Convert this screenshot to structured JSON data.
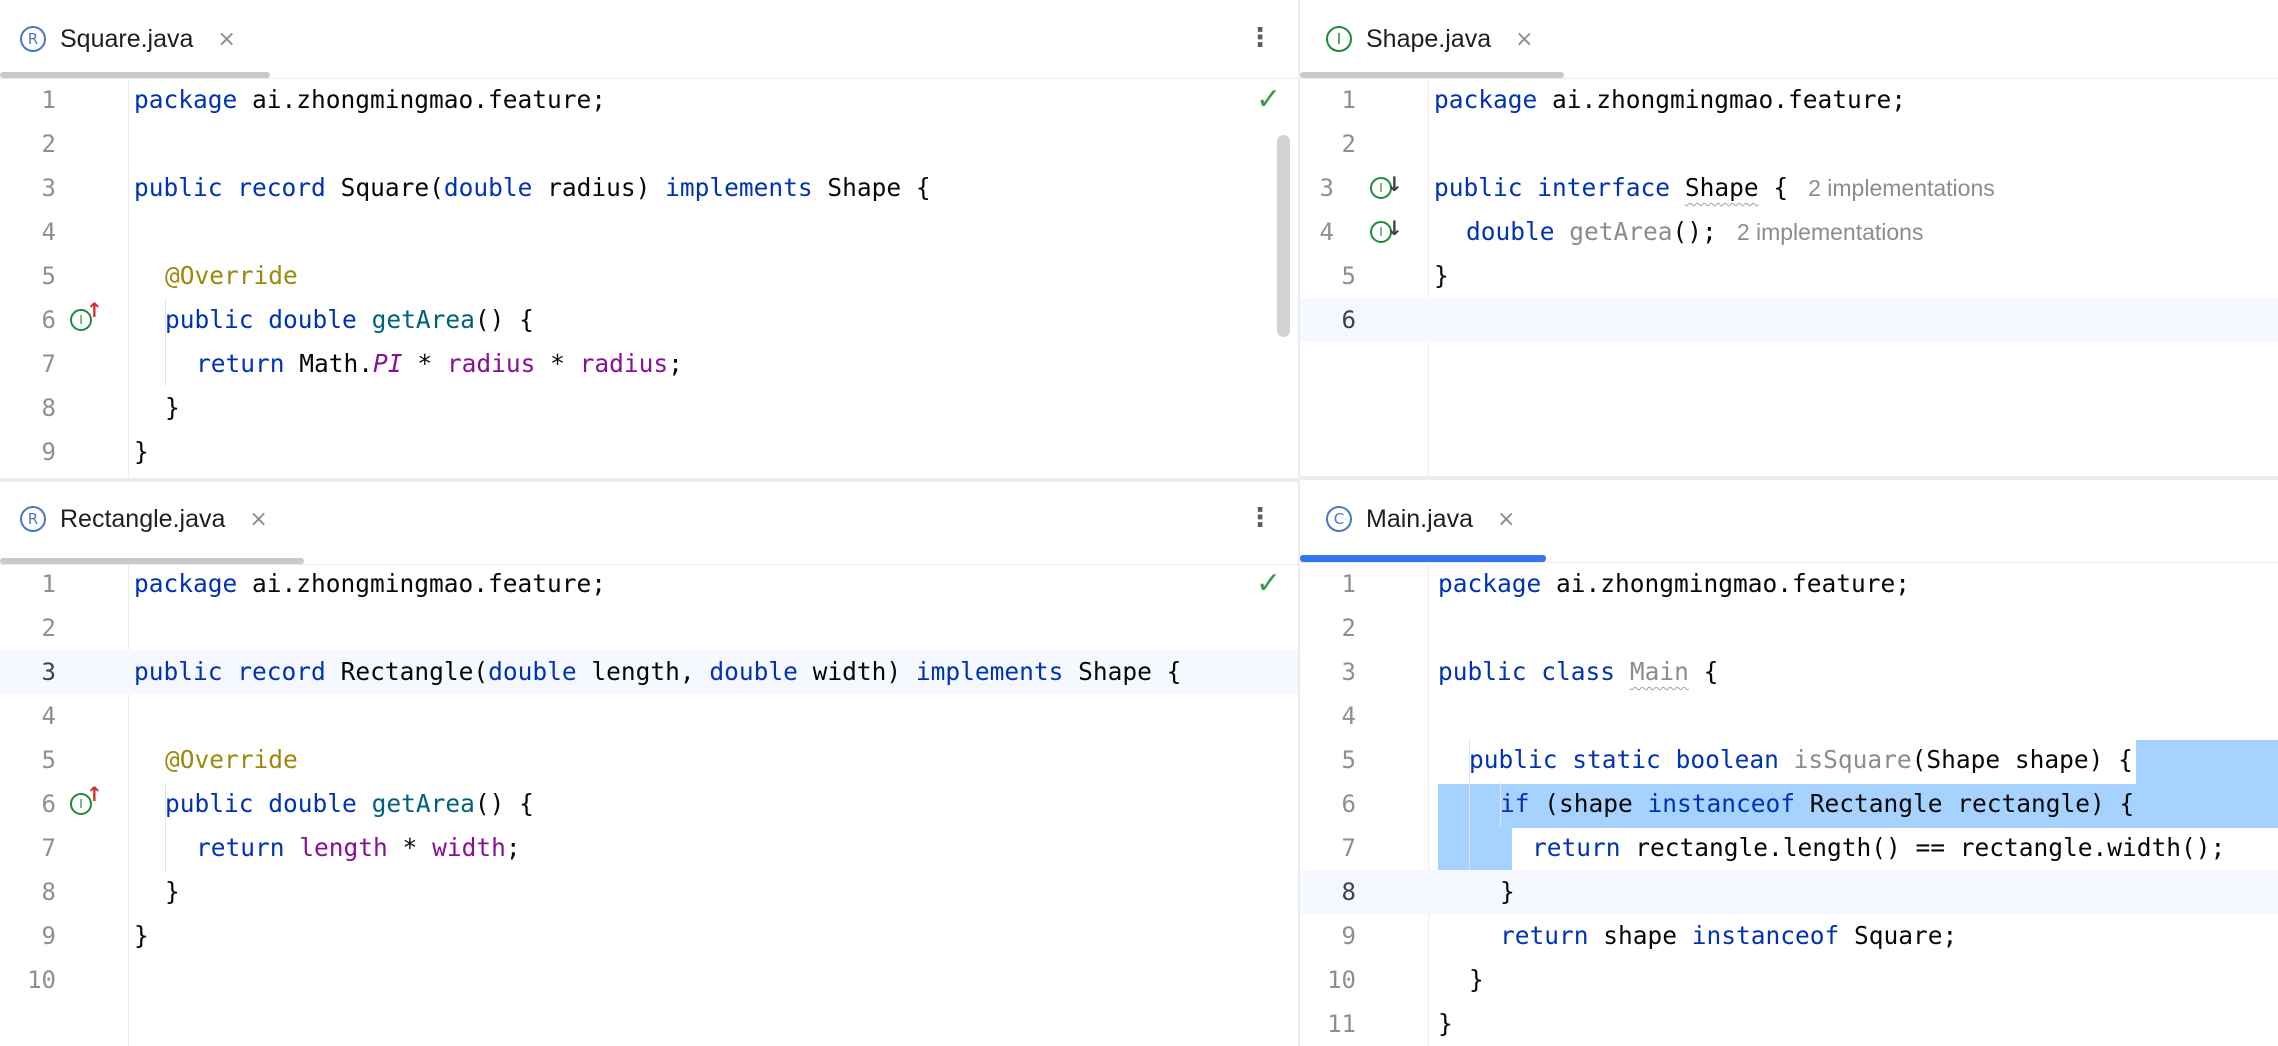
{
  "panes": {
    "square": {
      "tab": {
        "name": "Square.java",
        "icon_letter": "R",
        "icon": "record-icon",
        "close": "×"
      },
      "lines": [
        "1",
        "2",
        "3",
        "4",
        "5",
        "6",
        "7",
        "8",
        "9"
      ]
    },
    "shape": {
      "tab": {
        "name": "Shape.java",
        "icon_letter": "I",
        "icon": "interface-icon",
        "close": "×"
      },
      "lines": [
        "1",
        "2",
        "3",
        "4",
        "5",
        "6"
      ],
      "hint_3": "2 implementations",
      "hint_4": "2 implementations"
    },
    "rectangle": {
      "tab": {
        "name": "Rectangle.java",
        "icon_letter": "R",
        "icon": "record-icon",
        "close": "×"
      },
      "lines": [
        "1",
        "2",
        "3",
        "4",
        "5",
        "6",
        "7",
        "8",
        "9",
        "10"
      ]
    },
    "main": {
      "tab": {
        "name": "Main.java",
        "icon_letter": "C",
        "icon": "class-icon",
        "close": "×"
      },
      "lines": [
        "1",
        "2",
        "3",
        "4",
        "5",
        "6",
        "7",
        "8",
        "9",
        "10",
        "11"
      ]
    }
  },
  "tokens": {
    "package": "package",
    "pkg_name": " ai.zhongmingmao.feature;",
    "public": "public",
    "record": "record",
    "interface": "interface",
    "class": "class",
    "static": "static",
    "boolean": "boolean",
    "double": "double",
    "implements": "implements",
    "return": "return",
    "if": "if",
    "instanceof": "instanceof",
    "override": "@Override",
    "square_name": "Square",
    "rectangle_name": "Rectangle",
    "shape_name": "Shape",
    "main_name": "Main",
    "getArea": "getArea",
    "isSquare": "isSquare",
    "radius": "radius",
    "length": "length",
    "width": "width",
    "math": "Math.",
    "pi": "PI",
    "times": " * ",
    "open_brace": " {",
    "close_brace": "}",
    "paren_close_brace": "() {",
    "semi": ";",
    "square_params_1": "(",
    "square_params_2": " radius) ",
    "rect_params_1": "(",
    "rect_params_2": " length, ",
    "rect_params_3": " width) ",
    "shape_space": " Shape {",
    "getarea_decl": "();",
    "issquare_params": "(Shape shape) {",
    "if_cond_1": " (shape ",
    "if_cond_2": " Rectangle rectangle) {",
    "return_cmp": " rectangle.length() == rectangle.width();",
    "return_shape": " shape ",
    "square_semi": " Square;"
  },
  "colors": {
    "keyword": "#0033b3",
    "method": "#00627a",
    "field": "#871094",
    "annotation": "#9e880d",
    "selection": "#a6d2ff",
    "active_tab": "#3574f0"
  }
}
